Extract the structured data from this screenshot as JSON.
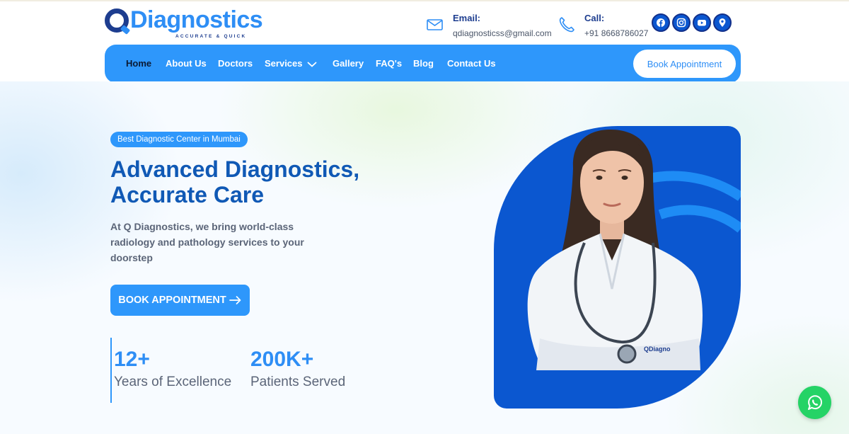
{
  "brand": {
    "logo_word": "Diagnostics",
    "tagline": "ACCURATE & QUICK",
    "color_primary": "#2e97fb",
    "color_dark": "#1d3d8f"
  },
  "contact": {
    "email_label": "Email:",
    "email_value": "qdiagnosticss@gmail.com",
    "call_label": "Call:",
    "call_value": "+91 8668786027"
  },
  "social": {
    "icons": [
      "facebook-icon",
      "instagram-icon",
      "youtube-icon",
      "location-pin-icon"
    ]
  },
  "nav": {
    "items": [
      {
        "label": "Home",
        "active": true
      },
      {
        "label": "About Us"
      },
      {
        "label": "Doctors"
      },
      {
        "label": "Services",
        "has_dropdown": true
      },
      {
        "label": "Gallery"
      },
      {
        "label": "FAQ's"
      },
      {
        "label": "Blog"
      },
      {
        "label": "Contact Us"
      }
    ],
    "book_label": "Book Appointment"
  },
  "hero": {
    "badge": "Best Diagnostic Center in Mumbai",
    "headline_line1": "Advanced Diagnostics,",
    "headline_line2": "Accurate Care",
    "subtext": "At Q Diagnostics, we bring world-class radiology and pathology services to your doorstep",
    "cta_label": "BOOK APPOINTMENT",
    "cta_icon": "arrow-right-icon",
    "stats": [
      {
        "value": "12+",
        "label": "Years of Excellence"
      },
      {
        "value": "200K+",
        "label": "Patients Served"
      }
    ],
    "coat_logo": "QDiagno"
  },
  "floating": {
    "whatsapp_icon": "whatsapp-icon",
    "whatsapp_color": "#25d366"
  }
}
